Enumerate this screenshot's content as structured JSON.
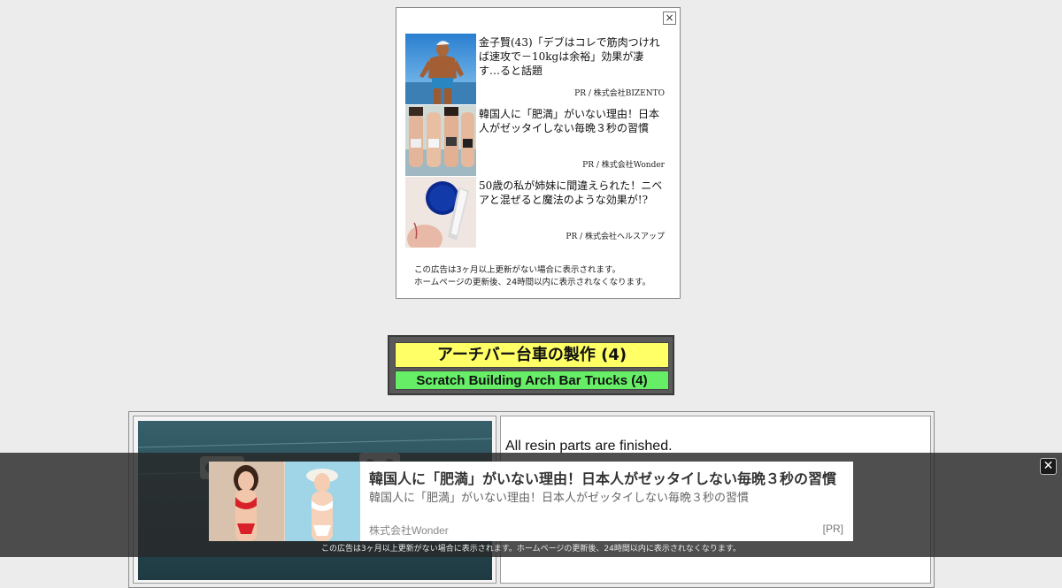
{
  "top_ad": {
    "close_label": "×",
    "items": [
      {
        "title": "金子賢(43)「デブはコレで筋肉つければ速攻で－10kgは余裕」効果が凄す…ると話題",
        "sponsor": "PR / 株式会社BIZENTO"
      },
      {
        "title": "韓国人に「肥満」がいない理由！日本人がゼッタイしない毎晩３秒の習慣",
        "sponsor": "PR / 株式会社Wonder"
      },
      {
        "title": "50歳の私が姉妹に間違えられた！ニベアと混ぜると魔法のような効果が!?",
        "sponsor": "PR / 株式会社ヘルスアップ"
      }
    ],
    "footnote_line1": "この広告は3ヶ月以上更新がない場合に表示されます。",
    "footnote_line2": "ホームページの更新後、24時間以内に表示されなくなります。"
  },
  "heading": {
    "jp": "アーチバー台車の製作 (4)",
    "en": "Scratch Building Arch Bar Trucks (4)"
  },
  "content": {
    "text": "All resin parts are finished."
  },
  "bottom_ad": {
    "title": "韓国人に「肥満」がいない理由！日本人がゼッタイしない毎晩３秒の習慣",
    "description": "韓国人に「肥満」がいない理由！日本人がゼッタイしない毎晩３秒の習慣",
    "sponsor": "株式会社Wonder",
    "pr_label": "[PR]",
    "close_label": "✕",
    "footnote": "この広告は3ヶ月以上更新がない場合に表示されます。ホームページの更新後、24時間以内に表示されなくなります。"
  }
}
